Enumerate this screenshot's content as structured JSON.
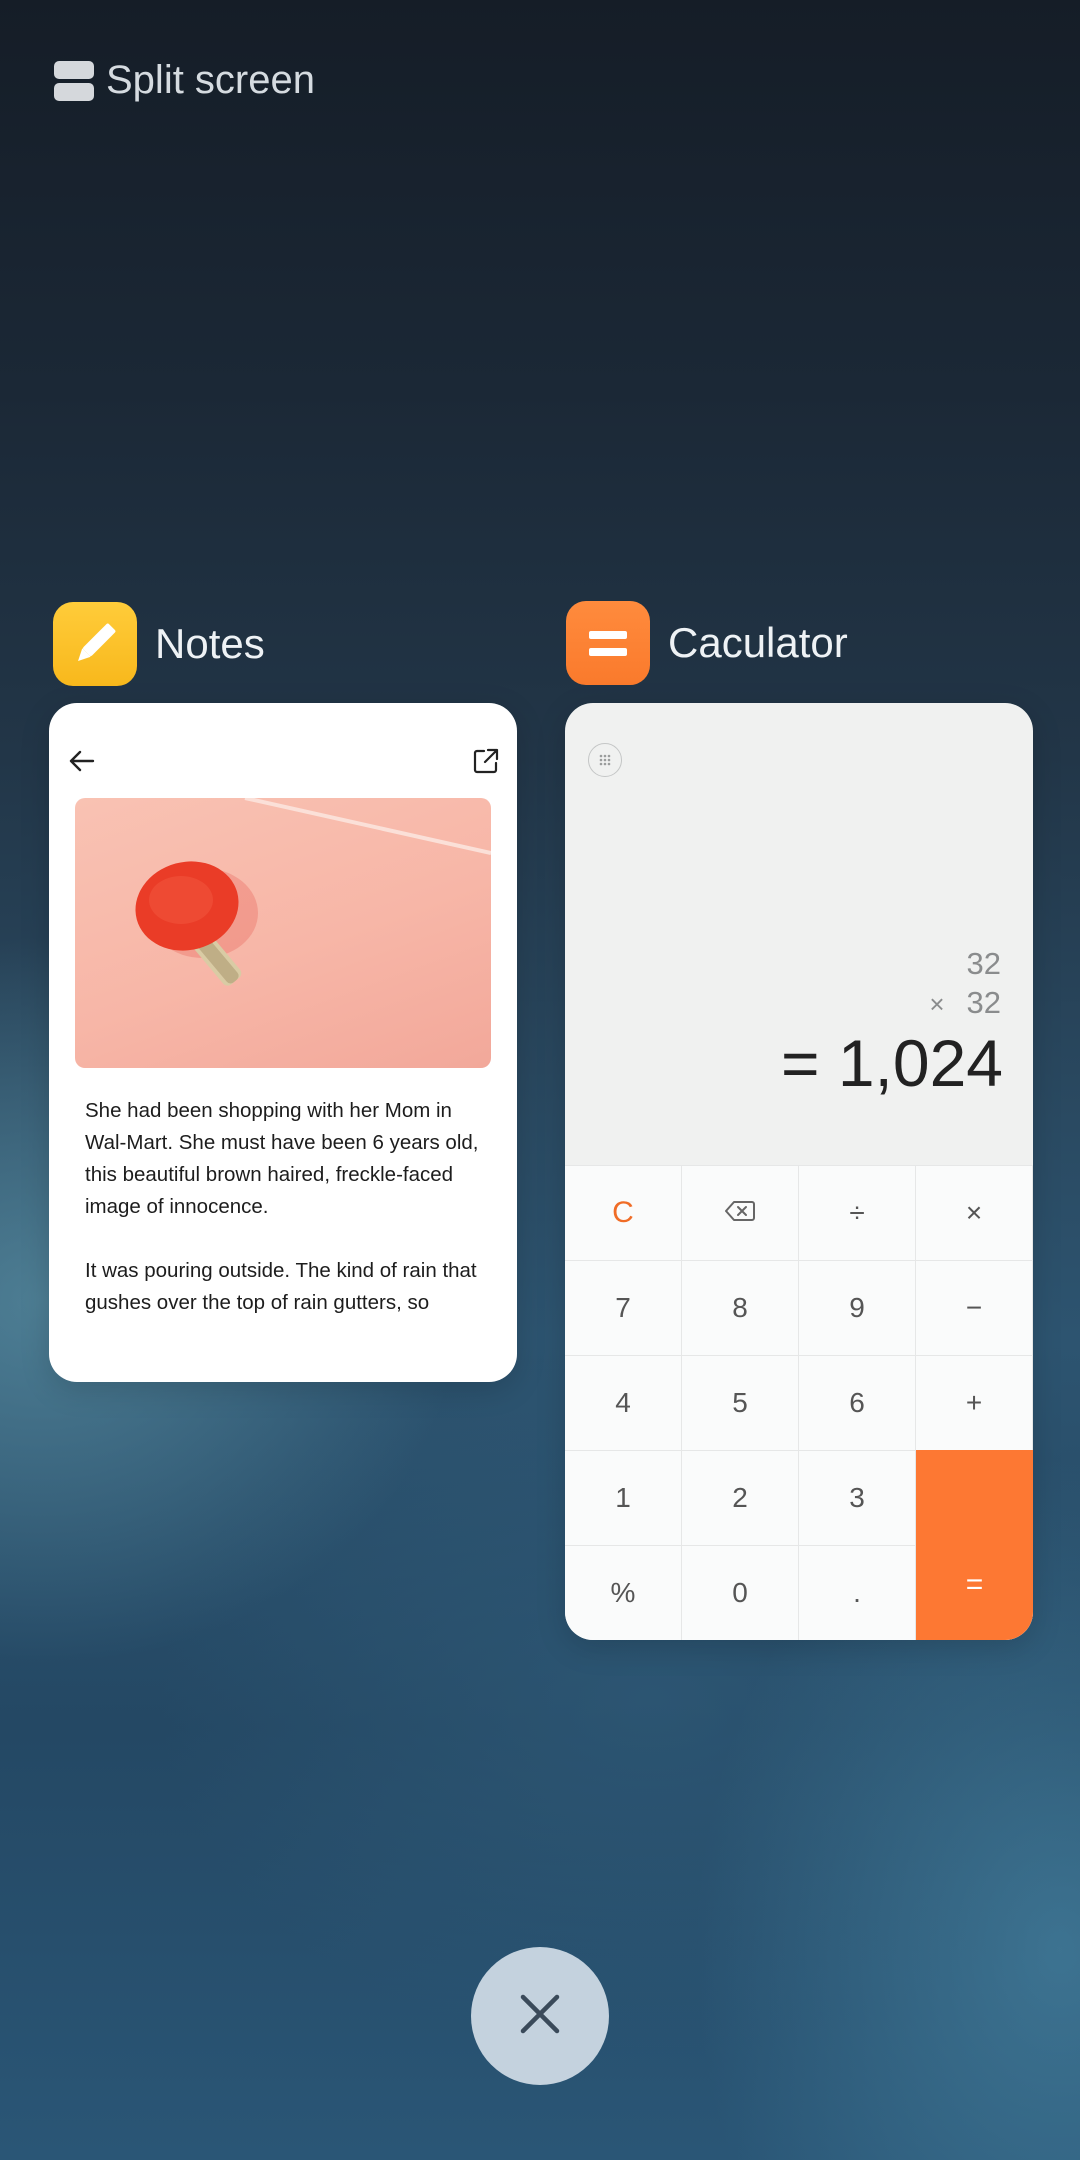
{
  "split_screen": {
    "label": "Split screen",
    "icon": "split-screen-icon"
  },
  "notes": {
    "app_name": "Notes",
    "icon": "notes-pencil-icon",
    "paragraphs": [
      "She had been shopping with her Mom in Wal-Mart. She must have been 6 years old, this beautiful brown haired, freckle-faced image of innocence.",
      "It was pouring outside. The kind of rain that gushes over the top of rain gutters, so"
    ]
  },
  "calculator": {
    "app_name": "Caculator",
    "icon": "calculator-icon",
    "operand1": "32",
    "operator": "×",
    "operand2": "32",
    "result": "= 1,024",
    "keys": {
      "clear": "C",
      "backspace": "⌫",
      "divide": "÷",
      "multiply": "×",
      "seven": "7",
      "eight": "8",
      "nine": "9",
      "minus": "−",
      "four": "4",
      "five": "5",
      "six": "6",
      "plus": "+",
      "one": "1",
      "two": "2",
      "three": "3",
      "percent": "%",
      "zero": "0",
      "dot": ".",
      "equals": "="
    }
  },
  "close_button": {
    "icon": "close-icon"
  }
}
